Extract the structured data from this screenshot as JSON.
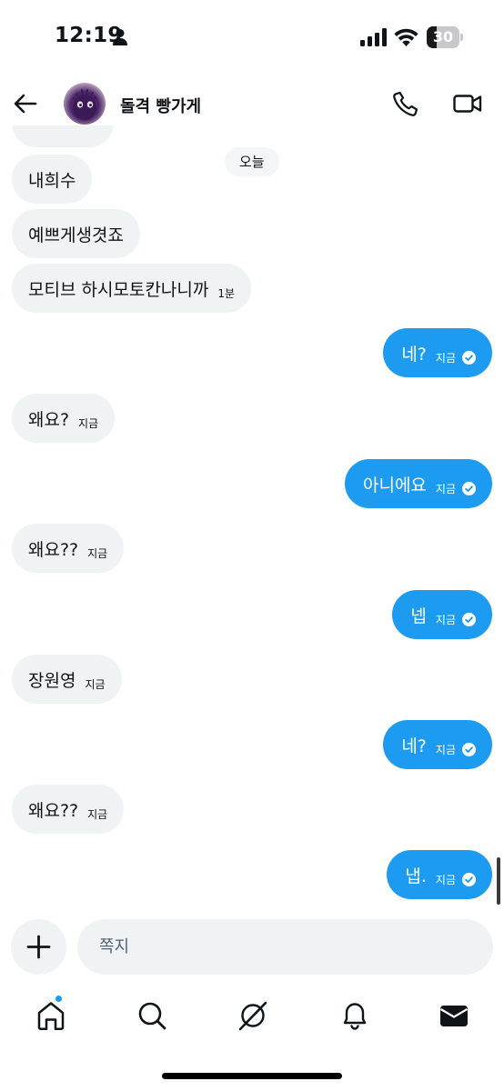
{
  "status_bar": {
    "time": "12:19",
    "battery": "30",
    "battery_fraction": 0.3
  },
  "header": {
    "back_icon": "arrow-left-icon",
    "conversation_name": "돌격 빵가게",
    "call_icon": "phone-icon",
    "video_icon": "video-camera-icon"
  },
  "conversation": {
    "date_separator": "오늘",
    "messages": [
      {
        "direction": "in",
        "text": "내희수",
        "time": ""
      },
      {
        "direction": "in",
        "text": "예쁘게생겻죠",
        "time": ""
      },
      {
        "direction": "in",
        "text": "모티브 하시모토칸나니까",
        "time": "1분"
      },
      {
        "direction": "out",
        "text": "네?",
        "time": "지금",
        "status_icon": "check-circle-icon"
      },
      {
        "direction": "in",
        "text": "왜요?",
        "time": "지금"
      },
      {
        "direction": "out",
        "text": "아니에요",
        "time": "지금",
        "status_icon": "check-circle-icon"
      },
      {
        "direction": "in",
        "text": "왜요??",
        "time": "지금"
      },
      {
        "direction": "out",
        "text": "넵",
        "time": "지금",
        "status_icon": "check-circle-icon"
      },
      {
        "direction": "in",
        "text": "장원영",
        "time": "지금"
      },
      {
        "direction": "out",
        "text": "네?",
        "time": "지금",
        "status_icon": "check-circle-icon"
      },
      {
        "direction": "in",
        "text": "왜요??",
        "time": "지금"
      },
      {
        "direction": "out",
        "text": "냅.",
        "time": "지금",
        "status_icon": "check-circle-icon"
      }
    ]
  },
  "composer": {
    "add_icon": "plus-icon",
    "placeholder": "쪽지"
  },
  "bottom_nav": {
    "items": [
      "home-icon",
      "search-icon",
      "grok-icon",
      "notifications-bell-icon",
      "messages-envelope-icon"
    ],
    "home_has_unread_dot": true
  },
  "colors": {
    "accent": "#1d9bf0",
    "incoming_bubble": "#eff3f4",
    "text": "#0f1419"
  }
}
